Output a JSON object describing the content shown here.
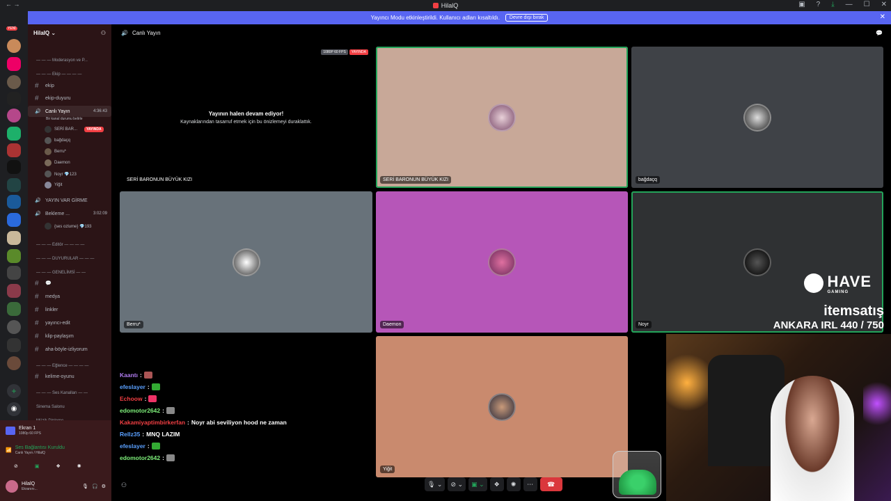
{
  "window": {
    "title": "HilalQ",
    "new_badge": "YENİ"
  },
  "banner": {
    "text": "Yayıncı Modu etkinleştirildi. Kullanıcı adları kısaltıldı.",
    "button": "Devre dışı bırak"
  },
  "server": {
    "name": "HilalQ"
  },
  "header": {
    "channel": "Canlı Yayın"
  },
  "sidebar": {
    "rows": [
      {
        "type": "cat",
        "label": "— — — Moderasyon ve P..."
      },
      {
        "type": "cat",
        "label": "— — — Ekip — — — —"
      },
      {
        "type": "ch",
        "label": "ekip"
      },
      {
        "type": "ch",
        "label": "ekip-duyuru"
      },
      {
        "type": "voice",
        "label": "Canlı Yayın",
        "time": "4:36:43",
        "sub": "Bir kanal durumu belirle"
      },
      {
        "type": "user",
        "label": "SERİ BAR...",
        "live": "YAYINDA"
      },
      {
        "type": "user",
        "label": "bağdaçq"
      },
      {
        "type": "user",
        "label": "Berru*"
      },
      {
        "type": "user",
        "label": "Daemon"
      },
      {
        "type": "user",
        "label": "Noyr 💎123"
      },
      {
        "type": "user",
        "label": "Yiğit"
      },
      {
        "type": "voice",
        "label": "YAYIN VAR GİRME"
      },
      {
        "type": "voice",
        "label": "Bekleme ...",
        "time": "3:02:09"
      },
      {
        "type": "user",
        "label": "{ses ozlume} 💎193"
      },
      {
        "type": "cat",
        "label": "— — — Editör — — — —"
      },
      {
        "type": "cat",
        "label": "— — — DUYURULAR — — —"
      },
      {
        "type": "cat",
        "label": "— — — GENELİMSİ — —"
      },
      {
        "type": "ch",
        "label": "💬"
      },
      {
        "type": "ch",
        "label": "medya"
      },
      {
        "type": "ch",
        "label": "linkler"
      },
      {
        "type": "ch",
        "label": "yayıncı-edit"
      },
      {
        "type": "ch",
        "label": "klip-paylaşım"
      },
      {
        "type": "ch",
        "label": "aha-böyle-izliyorum"
      },
      {
        "type": "cat",
        "label": "— — — Eğlence — — — —"
      },
      {
        "type": "ch",
        "label": "kelime-oyunu"
      },
      {
        "type": "cat",
        "label": "— — — Ses Kanalları — —"
      },
      {
        "type": "cat",
        "label": "Sinema Salonu"
      },
      {
        "type": "cat",
        "label": "Müzik Dinleme"
      }
    ]
  },
  "userpanel": {
    "screen_share": "Ekran 1",
    "screen_sub": "1080p 60 FPS",
    "voice_status": "Ses Bağlantısı Kuruldu",
    "voice_sub": "Canlı Yayın / HilalQ",
    "user": "HilalQ",
    "user_sub": "Ekranını..."
  },
  "tiles": {
    "stream": {
      "title": "Yayının halen devam ediyor!",
      "sub": "Kaynaklarından tasarruf etmek için bu önizlemeyi duraklattık.",
      "name": "SERİ BARONUN BÜYÜK KIZI",
      "fps": "1080P 60 FPS",
      "live": "YAYINDA"
    },
    "t1": {
      "name": "SERİ BARONUN BÜYÜK KIZI",
      "bg": "#c8a898"
    },
    "t2": {
      "name": "bağdaçq",
      "bg": "#3f4247"
    },
    "t3": {
      "name": "Berru*",
      "bg": "#68727a"
    },
    "t4": {
      "name": "Daemon",
      "bg": "#b656b8"
    },
    "t5": {
      "name": "Noyr",
      "bg": "#2f3133"
    },
    "t6": {
      "name": "Yiğit",
      "bg": "#c98a6e"
    }
  },
  "chat": [
    {
      "user": "Kaantı",
      "color": "#b07cf0",
      "text": ""
    },
    {
      "user": "efeslayer",
      "color": "#5aa0ff",
      "text": ""
    },
    {
      "user": "Echoow",
      "color": "#f23f43",
      "text": ""
    },
    {
      "user": "edomotor2642",
      "color": "#7ef07a",
      "text": ""
    },
    {
      "user": "Kakamiyaptimbirkerfan",
      "color": "#f23f43",
      "text": "Noyr abi seviliyon hood ne zaman"
    },
    {
      "user": "Rellz35",
      "color": "#5aa0ff",
      "text": "MNQ LAZIM"
    },
    {
      "user": "efeslayer",
      "color": "#5aa0ff",
      "text": ""
    },
    {
      "user": "edomotor2642",
      "color": "#7ef07a",
      "text": ""
    }
  ],
  "overlay": {
    "brand1": "HAVE",
    "brand1_sub": "GAMING",
    "brand2": "itemsatış",
    "counter": "ANKARA IRL 440 / 750"
  }
}
